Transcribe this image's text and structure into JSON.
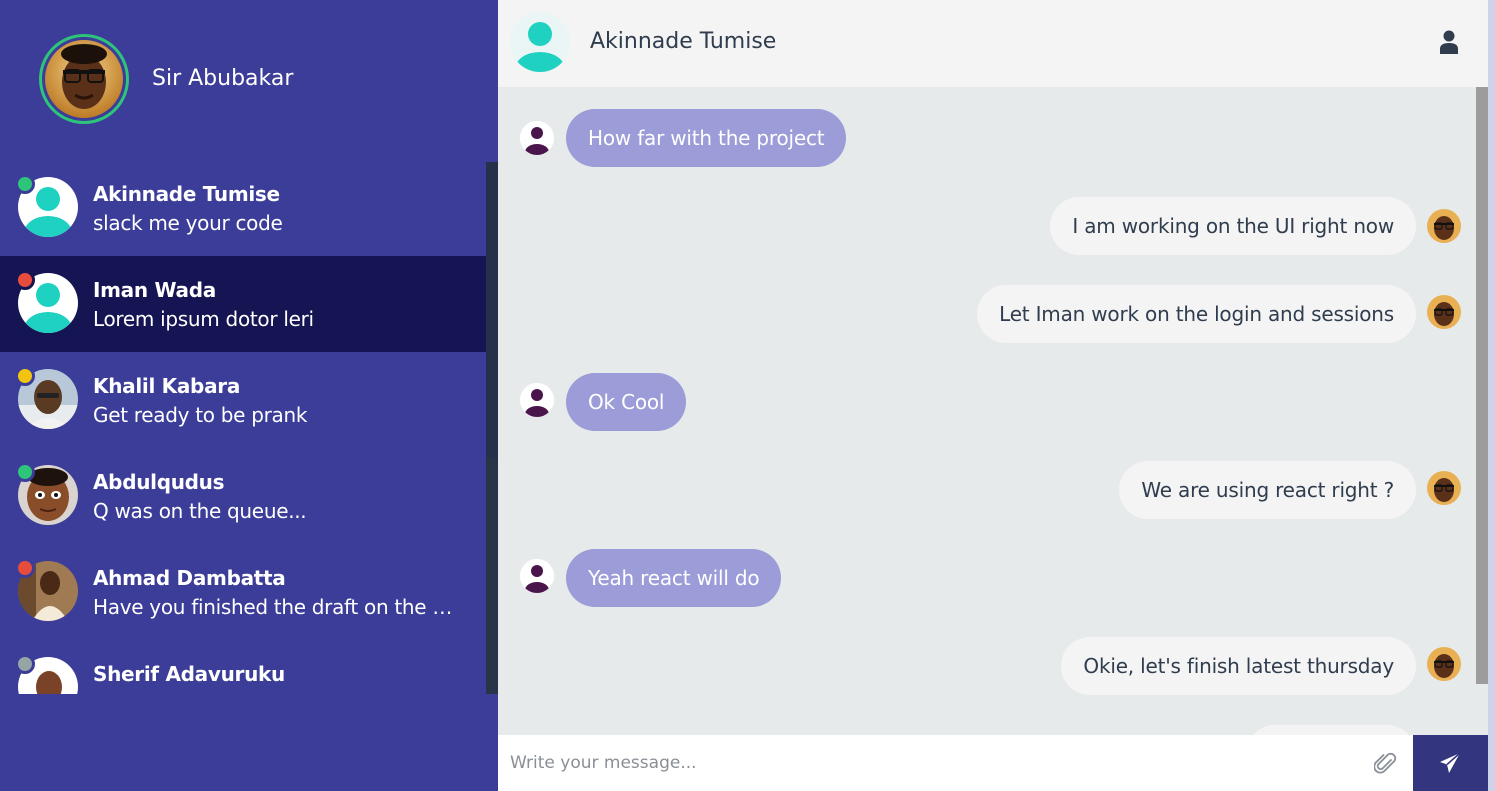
{
  "profile": {
    "name": "Sir Abubakar",
    "avatar_icon": "profile-photo-icon"
  },
  "contacts": [
    {
      "name": "Akinnade Tumise",
      "preview": "slack me your code",
      "status": "online",
      "status_color": "#2ec47a",
      "avatar_icon": "default-user-icon"
    },
    {
      "name": "Iman Wada",
      "preview": "Lorem ipsum dotor leri",
      "status": "busy",
      "status_color": "#e74c3c",
      "avatar_icon": "default-user-icon",
      "active": true
    },
    {
      "name": "Khalil Kabara",
      "preview": "Get ready to be prank",
      "status": "away",
      "status_color": "#f1c40f",
      "avatar_icon": "photo-icon"
    },
    {
      "name": "Abdulqudus",
      "preview": "Q was on the queue...",
      "status": "online",
      "status_color": "#2ec47a",
      "avatar_icon": "photo-icon"
    },
    {
      "name": "Ahmad Dambatta",
      "preview": "Have you finished the draft on the H…",
      "status": "busy",
      "status_color": "#e74c3c",
      "avatar_icon": "photo-icon"
    },
    {
      "name": "Sherif Adavuruku",
      "preview": "",
      "status": "offline",
      "status_color": "#95a5a6",
      "avatar_icon": "photo-icon"
    }
  ],
  "chat": {
    "contact_name": "Akinnade Tumise",
    "header_icon": "user-icon",
    "messages": [
      {
        "direction": "incoming",
        "text": "How far with the project"
      },
      {
        "direction": "outgoing",
        "text": "I am working on the UI right now"
      },
      {
        "direction": "outgoing",
        "text": "Let Iman work on the login and sessions"
      },
      {
        "direction": "incoming",
        "text": "Ok Cool"
      },
      {
        "direction": "outgoing",
        "text": "We are using react right ?"
      },
      {
        "direction": "incoming",
        "text": "Yeah react will do"
      },
      {
        "direction": "outgoing",
        "text": "Okie, let's finish latest thursday"
      }
    ]
  },
  "composer": {
    "placeholder": "Write your message...",
    "attach_icon": "paperclip-icon",
    "send_icon": "paper-plane-icon"
  },
  "colors": {
    "sidebar": "#3b3d98",
    "active_contact": "#141552",
    "incoming_bubble": "#9b9cd8",
    "outgoing_bubble": "#f4f4f4",
    "send_button": "#33367f",
    "teal_avatar": "#1ed1c1"
  }
}
